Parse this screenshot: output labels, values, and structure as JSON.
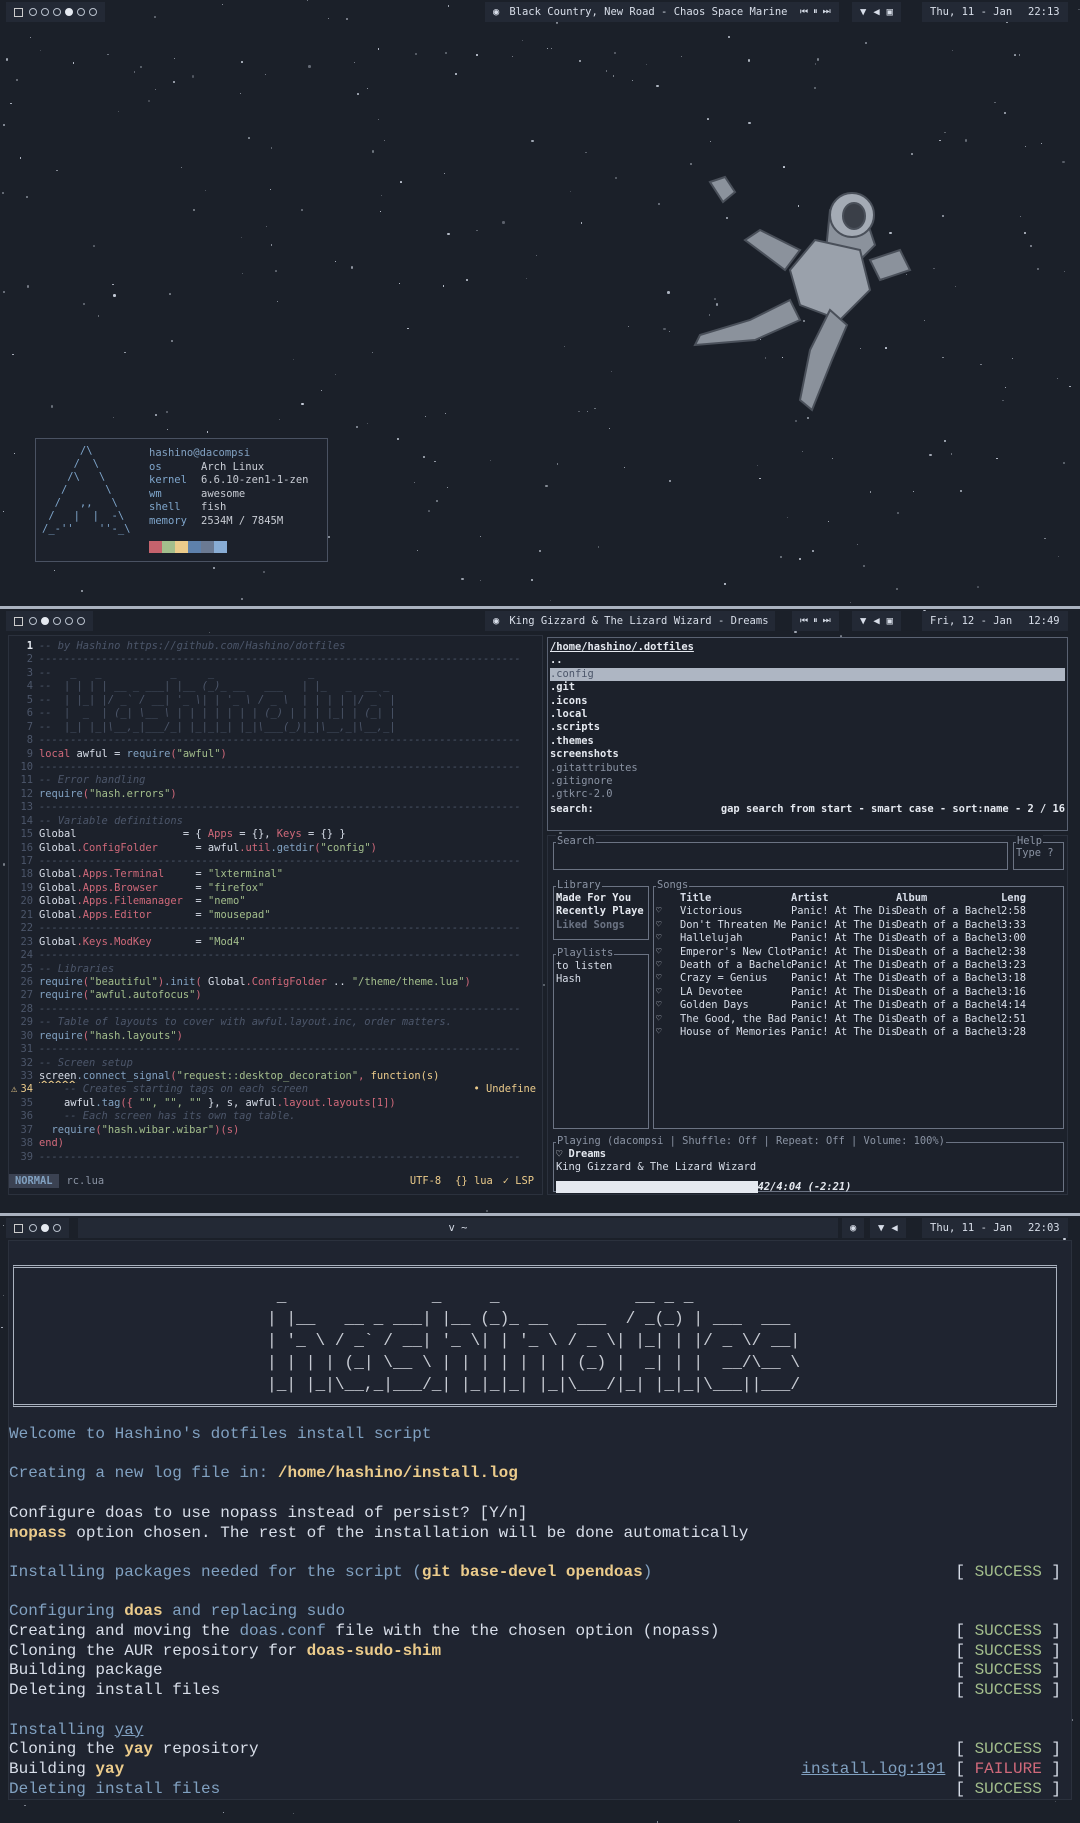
{
  "screen1": {
    "bar": {
      "tags": [
        0,
        0,
        0,
        1,
        0,
        0
      ],
      "now_playing": "Black Country, New Road - Chaos Space Marine",
      "date": "Thu, 11 - Jan",
      "time": "22:13"
    },
    "fetch": {
      "art": "      /\\\n     /  \\\n    /\\   \\\n   /      \\\n  /   ,,   \\\n /   |  |  -\\\n/_-''    ''-_\\",
      "user": "hashino@dacompsi",
      "rows": [
        {
          "k": "os",
          "v": "Arch Linux"
        },
        {
          "k": "kernel",
          "v": "6.6.10-zen1-1-zen"
        },
        {
          "k": "wm",
          "v": "awesome"
        },
        {
          "k": "shell",
          "v": "fish"
        },
        {
          "k": "memory",
          "v": "2534M / 7845M"
        }
      ],
      "colors": [
        "#c5636d",
        "#a3be8c",
        "#ebcb8b",
        "#5e81ac",
        "#6b7a93",
        "#88acd4"
      ]
    }
  },
  "screen2": {
    "bar": {
      "tags": [
        0,
        1,
        0,
        0,
        0
      ],
      "now_playing": "King Gizzard & The Lizard Wizard - Dreams",
      "date": "Fri, 12 - Jan",
      "time": "12:49"
    },
    "editor": {
      "lines": [
        [
          [
            "-- by Hashino https://github.com/Hashino/dotfiles",
            "cm"
          ]
        ],
        [
          [
            "-----------------------------------------------------------------------------",
            "cm"
          ]
        ],
        [
          [
            "--   _   _           _     _               _",
            "cm"
          ]
        ],
        [
          [
            "--  | | | | __ _ ___| |__ (_)_ __   ___   | |_   _  __ _",
            "cm"
          ]
        ],
        [
          [
            "--  | |_| |/ _` / __| '_ \\| | '_ \\ / _ \\  | | | | |/ _` |",
            "cm"
          ]
        ],
        [
          [
            "--  |  _  | (_| \\__ \\ | | | | | | | (_) | | | |_| | (_| |",
            "cm"
          ]
        ],
        [
          [
            "--  |_| |_|\\__,_|___/_| |_|_|_| |_|\\___(_)|_|\\__,_|\\__,_|",
            "cm"
          ]
        ],
        [
          [
            "-----------------------------------------------------------------------------",
            "cm"
          ]
        ],
        [
          [
            "local",
            "kw"
          ],
          [
            " awful = ",
            "tx"
          ],
          [
            "require",
            "fn"
          ],
          [
            "(",
            "p"
          ],
          [
            "\"awful\"",
            "str"
          ],
          [
            ")",
            "p"
          ]
        ],
        [
          [
            "-----------------------------------------------------------------------------",
            "cm"
          ]
        ],
        [
          [
            "-- Error handling",
            "cm"
          ]
        ],
        [
          [
            "require",
            "fn"
          ],
          [
            "(",
            "p"
          ],
          [
            "\"hash.errors\"",
            "str"
          ],
          [
            ")",
            "p"
          ]
        ],
        [
          [
            "-----------------------------------------------------------------------------",
            "cm"
          ]
        ],
        [
          [
            "-- Variable definitions",
            "cm"
          ]
        ],
        [
          [
            "Global",
            "tx"
          ],
          [
            "                 = { ",
            "tx"
          ],
          [
            "Apps",
            "kw"
          ],
          [
            " = {}, ",
            "tx"
          ],
          [
            "Keys",
            "kw"
          ],
          [
            " = {} }",
            "tx"
          ]
        ],
        [
          [
            "Global",
            "tx"
          ],
          [
            ".ConfigFolder",
            "kw"
          ],
          [
            "      = awful",
            "tx"
          ],
          [
            ".util",
            "kw"
          ],
          [
            ".getdir",
            "fn"
          ],
          [
            "(",
            "p"
          ],
          [
            "\"config\"",
            "str"
          ],
          [
            ")",
            "p"
          ]
        ],
        [
          [
            "-----------------------------------------------------------------------------",
            "cm"
          ]
        ],
        [
          [
            "Global",
            "tx"
          ],
          [
            ".Apps.Terminal",
            "kw"
          ],
          [
            "     = ",
            "tx"
          ],
          [
            "\"lxterminal\"",
            "str"
          ]
        ],
        [
          [
            "Global",
            "tx"
          ],
          [
            ".Apps.Browser",
            "kw"
          ],
          [
            "      = ",
            "tx"
          ],
          [
            "\"firefox\"",
            "str"
          ]
        ],
        [
          [
            "Global",
            "tx"
          ],
          [
            ".Apps.Filemanager",
            "kw"
          ],
          [
            "  = ",
            "tx"
          ],
          [
            "\"nemo\"",
            "str"
          ]
        ],
        [
          [
            "Global",
            "tx"
          ],
          [
            ".Apps.Editor",
            "kw"
          ],
          [
            "       = ",
            "tx"
          ],
          [
            "\"mousepad\"",
            "str"
          ]
        ],
        [
          [
            "-----------------------------------------------------------------------------",
            "cm"
          ]
        ],
        [
          [
            "Global",
            "tx"
          ],
          [
            ".Keys.ModKey",
            "kw"
          ],
          [
            "       = ",
            "tx"
          ],
          [
            "\"Mod4\"",
            "str"
          ]
        ],
        [
          [
            "-----------------------------------------------------------------------------",
            "cm"
          ]
        ],
        [
          [
            "-- Libraries",
            "cm"
          ]
        ],
        [
          [
            "require",
            "fn"
          ],
          [
            "(",
            "p"
          ],
          [
            "\"beautiful\"",
            "str"
          ],
          [
            ")",
            "p"
          ],
          [
            ".init",
            "fn"
          ],
          [
            "(",
            "p"
          ],
          [
            " Global",
            "tx"
          ],
          [
            ".ConfigFolder",
            "kw"
          ],
          [
            " .. ",
            "tx"
          ],
          [
            "\"/theme/theme.lua\"",
            "str"
          ],
          [
            ")",
            "p"
          ]
        ],
        [
          [
            "require",
            "fn"
          ],
          [
            "(",
            "p"
          ],
          [
            "\"awful.autofocus\"",
            "str"
          ],
          [
            ")",
            "p"
          ]
        ],
        [
          [
            "-----------------------------------------------------------------------------",
            "cm"
          ]
        ],
        [
          [
            "-- Table of layouts to cover with awful.layout.inc, order matters.",
            "cm"
          ]
        ],
        [
          [
            "require",
            "fn"
          ],
          [
            "(",
            "p"
          ],
          [
            "\"hash.layouts\"",
            "str"
          ],
          [
            ")",
            "p"
          ]
        ],
        [
          [
            "-----------------------------------------------------------------------------",
            "cm"
          ]
        ],
        [
          [
            "-- Screen setup",
            "cm"
          ]
        ],
        [
          [
            "screen",
            "tx ul"
          ],
          [
            ".connect_signal",
            "fn"
          ],
          [
            "(",
            "p"
          ],
          [
            "\"request::desktop_decoration\"",
            "str"
          ],
          [
            ", ",
            "p"
          ],
          [
            "function(s)",
            "fu"
          ]
        ],
        [
          [
            "    -- Creates starting tags on each screen",
            "cm"
          ]
        ],
        [
          [
            "    awful",
            "tx"
          ],
          [
            ".tag",
            "fn"
          ],
          [
            "({ ",
            "p"
          ],
          [
            "\"\", \"\", \"\"",
            "str"
          ],
          [
            " }, s, awful",
            "tx"
          ],
          [
            ".layout.layouts[1]",
            "kw"
          ],
          [
            ")",
            "p"
          ]
        ],
        [
          [
            "    -- Each screen has its own tag table.",
            "cm"
          ]
        ],
        [
          [
            "  require",
            "fn"
          ],
          [
            "(",
            "p"
          ],
          [
            "\"hash.wibar.wibar\"",
            "str"
          ],
          [
            ")(s)",
            "p"
          ]
        ],
        [
          [
            "end",
            "kw"
          ],
          [
            ")",
            "p"
          ]
        ],
        [
          [
            "-----------------------------------------------------------------------------",
            "cm"
          ]
        ]
      ],
      "warning_line": 34,
      "diagnostic": "• Undefine",
      "mode": "NORMAL",
      "filename": "rc.lua",
      "encoding": "UTF-8",
      "filetype": "{} lua",
      "lsp": "✓ LSP"
    },
    "fm": {
      "path": "/home/hashino/.dotfiles",
      "items": [
        {
          "name": "..",
          "kind": "dir"
        },
        {
          "name": ".config",
          "kind": "sel"
        },
        {
          "name": ".git",
          "kind": "dir"
        },
        {
          "name": ".icons",
          "kind": "dir"
        },
        {
          "name": ".local",
          "kind": "dir"
        },
        {
          "name": ".scripts",
          "kind": "dir"
        },
        {
          "name": ".themes",
          "kind": "dir"
        },
        {
          "name": "screenshots",
          "kind": "dir"
        },
        {
          "name": ".gitattributes",
          "kind": "file"
        },
        {
          "name": ".gitignore",
          "kind": "file"
        },
        {
          "name": ".gtkrc-2.0",
          "kind": "file"
        }
      ],
      "search_label": "search:",
      "search_info": "gap search from start - smart case - sort:name - 2 / 16"
    },
    "music": {
      "search_title": "Search",
      "help_title": "Help",
      "help_text": "Type ?",
      "library_title": "Library",
      "library": [
        "Made For You",
        "Recently Playe",
        "Liked Songs"
      ],
      "playlists_title": "Playlists",
      "playlists": [
        "to listen",
        "Hash"
      ],
      "songs_title": "Songs",
      "columns": [
        "Title",
        "Artist",
        "Album",
        "Leng"
      ],
      "songs": [
        [
          "Victorious",
          "Panic! At The Disc",
          "Death of a Bachelo",
          "2:58"
        ],
        [
          "Don't Threaten Me",
          "Panic! At The Disc",
          "Death of a Bachelo",
          "3:33"
        ],
        [
          "Hallelujah",
          "Panic! At The Disc",
          "Death of a Bachelo",
          "3:00"
        ],
        [
          "Emperor's New Clot",
          "Panic! At The Disc",
          "Death of a Bachelo",
          "2:38"
        ],
        [
          "Death of a Bachelo",
          "Panic! At The Disc",
          "Death of a Bachelo",
          "3:23"
        ],
        [
          "Crazy = Genius",
          "Panic! At The Disc",
          "Death of a Bachelo",
          "3:18"
        ],
        [
          "LA Devotee",
          "Panic! At The Disc",
          "Death of a Bachelo",
          "3:16"
        ],
        [
          "Golden Days",
          "Panic! At The Disc",
          "Death of a Bachelo",
          "4:14"
        ],
        [
          "The Good, the Bad",
          "Panic! At The Disc",
          "Death of a Bachelo",
          "2:51"
        ],
        [
          "House of Memories",
          "Panic! At The Disc",
          "Death of a Bachelo",
          "3:28"
        ]
      ],
      "playing_title": "Playing (dacompsi | Shuffle: Off | Repeat: Off   | Volume: 100%)",
      "track": "♡ Dreams",
      "artist": "King Gizzard & The Lizard Wizard",
      "progress": 0.42,
      "time_text": "42/4:04 (-2:21)"
    }
  },
  "screen3": {
    "bar": {
      "tags": [
        0,
        1,
        0
      ],
      "title": "v ~",
      "date": "Thu, 11 - Jan",
      "time": "22:03"
    },
    "banner": " _               _     _              __ _ _\n| |__   __ _ ___| |__ (_)_ __   ___  / _(_) | ___  ___\n| '_ \\ / _` / __| '_ \\| | '_ \\ / _ \\| |_| | |/ _ \\/ __|\n| | | | (_| \\__ \\ | | | | | | | (_) |  _| | |  __/\\__ \\\n|_| |_|\\__,_|___/_| |_|_|_| |_|\\___/|_| |_|_|\\___||___/",
    "lines": [
      {
        "segs": [
          [
            "Welcome to Hashino's dotfiles install script",
            "bl"
          ]
        ]
      },
      {
        "segs": []
      },
      {
        "segs": [
          [
            "Creating a new log file in: ",
            "bl"
          ],
          [
            "/home/hashino/install.log",
            "ye"
          ]
        ]
      },
      {
        "segs": []
      },
      {
        "segs": [
          [
            "Configure doas to use nopass instead of persist? [Y/n]",
            "wh"
          ]
        ]
      },
      {
        "segs": [
          [
            "nopass",
            "ye"
          ],
          [
            " option chosen. The rest of the installation will be done automatically",
            "wh"
          ]
        ]
      },
      {
        "segs": []
      },
      {
        "segs": [
          [
            "Installing packages needed for the script (",
            "bl"
          ],
          [
            "git base-devel opendoas",
            "ye"
          ],
          [
            ")",
            "bl"
          ]
        ],
        "status": "SUCCESS"
      },
      {
        "segs": []
      },
      {
        "segs": [
          [
            "Configuring ",
            "bl"
          ],
          [
            "doas",
            "ye"
          ],
          [
            " and replacing ",
            "bl"
          ],
          [
            "sudo",
            "fn"
          ]
        ]
      },
      {
        "segs": [
          [
            "Creating and moving the ",
            "wh"
          ],
          [
            "doas.conf",
            "fn"
          ],
          [
            " file with the the chosen option (nopass)",
            "wh"
          ]
        ],
        "status": "SUCCESS"
      },
      {
        "segs": [
          [
            "Cloning the AUR repository for ",
            "wh"
          ],
          [
            "doas-sudo-shim",
            "ye"
          ]
        ],
        "status": "SUCCESS"
      },
      {
        "segs": [
          [
            "Building package",
            "wh"
          ]
        ],
        "status": "SUCCESS"
      },
      {
        "segs": [
          [
            "Deleting install files",
            "wh"
          ]
        ],
        "status": "SUCCESS"
      },
      {
        "segs": []
      },
      {
        "segs": [
          [
            "Installing ",
            "bl"
          ],
          [
            "yay",
            "bl lnk"
          ]
        ]
      },
      {
        "segs": [
          [
            "Cloning the ",
            "wh"
          ],
          [
            "yay",
            "ye"
          ],
          [
            " repository",
            "wh"
          ]
        ],
        "status": "SUCCESS"
      },
      {
        "segs": [
          [
            "Building ",
            "wh"
          ],
          [
            "yay",
            "ye"
          ]
        ],
        "status": "FAILURE",
        "link": "install.log:191"
      },
      {
        "segs": [
          [
            "Deleting install files",
            "bl"
          ]
        ],
        "status": "SUCCESS"
      }
    ]
  }
}
